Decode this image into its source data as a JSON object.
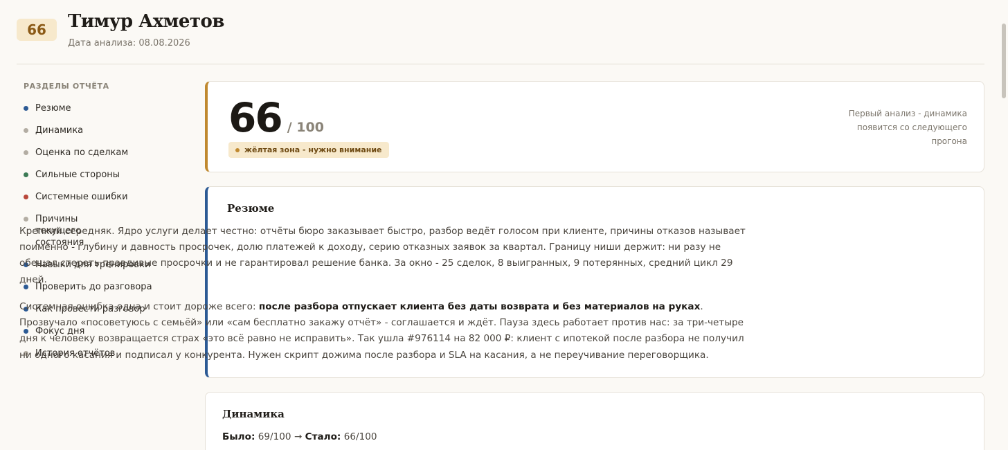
{
  "header": {
    "badge_score": "66",
    "name": "Тимур Ахметов",
    "date": "Дата анализа: 08.08.2026"
  },
  "sidebar": {
    "title": "РАЗДЕЛЫ ОТЧЁТА",
    "items": [
      {
        "label": "Резюме",
        "dot": "#2c5a94"
      },
      {
        "label": "Динамика",
        "dot": "#b3ada3"
      },
      {
        "label": "Оценка по сделкам",
        "dot": "#b3ada3"
      },
      {
        "label": "Сильные стороны",
        "dot": "#3b7a55"
      },
      {
        "label": "Системные ошибки",
        "dot": "#b9473a"
      },
      {
        "label": "Причины текущего состояния",
        "dot": "#b3ada3"
      },
      {
        "label": "Навыки для тренировки",
        "dot": "#2c5a94"
      },
      {
        "label": "Проверить до разговора",
        "dot": "#2c5a94"
      },
      {
        "label": "Как провести разговор",
        "dot": "#2c5a94"
      },
      {
        "label": "Фокус дня",
        "dot": "#2c5a94"
      },
      {
        "label": "История отчётов",
        "dot": "#b3ada3"
      }
    ]
  },
  "score": {
    "value": "66",
    "max": "/ 100",
    "zone": "жёлтая зона - нужно внимание",
    "note": "Первый анализ - динамика появится со следующего прогона"
  },
  "summary": {
    "title": "Резюме",
    "p1": "Крепкий середняк. Ядро услуги делает честно: отчёты бюро заказывает быстро, разбор ведёт голосом при клиенте, причины отказов называет поимённо - глубину и давность просрочек, долю платежей к доходу, серию отказных заявок за квартал. Границу ниши держит: ни разу не обещал стереть правдивые просрочки и не гарантировал решение банка. За окно - 25 сделок, 8 выигранных, 9 потерянных, средний цикл 29 дней.",
    "p2_start": "Системная ошибка одна и стоит дороже всего: ",
    "p2_bold": "после разбора отпускает клиента без даты возврата и без материалов на руках",
    "p2_end": ". Прозвучало «посоветуюсь с семьёй» или «сам бесплатно закажу отчёт» - соглашается и ждёт. Пауза здесь работает против нас: за три-четыре дня к человеку возвращается страх «это всё равно не исправить». Так ушла #976114 на 82 000 ₽: клиент с ипотекой после разбора не получил ни одного касания и подписал у конкурента. Нужен скрипт дожима после разбора и SLA на касания, а не переучивание переговорщика."
  },
  "dynamics": {
    "title": "Динамика",
    "before_label": "Было:",
    "before_value": "69/100",
    "arrow": "→",
    "after_label": "Стало:",
    "after_value": "66/100"
  }
}
